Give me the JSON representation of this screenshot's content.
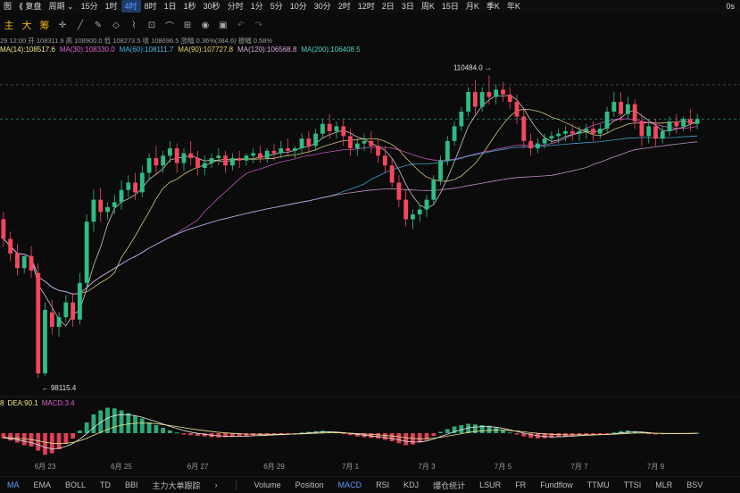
{
  "topbar": {
    "items": [
      {
        "label": "图",
        "icon": "chart-icon"
      },
      {
        "label": "⟪ 复盘"
      },
      {
        "label": "周期 ⌄"
      },
      {
        "label": "15分"
      },
      {
        "label": "1时"
      },
      {
        "label": "4时",
        "active": true
      },
      {
        "label": "8时"
      },
      {
        "label": "1日"
      },
      {
        "label": "1秒"
      },
      {
        "label": "30秒"
      },
      {
        "label": "分时"
      },
      {
        "label": "1分"
      },
      {
        "label": "5分"
      },
      {
        "label": "10分"
      },
      {
        "label": "30分"
      },
      {
        "label": "2时"
      },
      {
        "label": "12时"
      },
      {
        "label": "2日"
      },
      {
        "label": "3日"
      },
      {
        "label": "周K"
      },
      {
        "label": "15日"
      },
      {
        "label": "月K"
      },
      {
        "label": "季K"
      },
      {
        "label": "年K"
      }
    ],
    "countdown": "0s"
  },
  "toolbar": {
    "main": "主",
    "big": "大",
    "chips": "筹"
  },
  "info_line": "29 12:00 开 108311.9 高 108900.0 低 108273.5 收 108696.5 涨幅 0.36%(384.6) 振幅 0.58%",
  "ma_legend": [
    {
      "label": "MA(14):108517.6",
      "color": "#f0e68c"
    },
    {
      "label": "MA(30):108330.0",
      "color": "#e05fd4"
    },
    {
      "label": "MA(60):108111.7",
      "color": "#47b8e8"
    },
    {
      "label": "MA(90):107727.8",
      "color": "#e8d36a"
    },
    {
      "label": "MA(120):106568.8",
      "color": "#d9a7e0"
    },
    {
      "label": "MA(200):106408.5",
      "color": "#4ad6c6"
    }
  ],
  "macd_legend": [
    {
      "label": "8",
      "color": "#f0e68c"
    },
    {
      "label": "DEA:90.1",
      "color": "#f0e68c"
    },
    {
      "label": "MACD:3.4",
      "color": "#d864c8"
    }
  ],
  "annotations": {
    "high": "110484.0",
    "low": "98115.4"
  },
  "x_dates": [
    "6月 23",
    "6月 25",
    "6月 27",
    "6月 29",
    "7月 1",
    "7月 3",
    "7月 5",
    "7月 7",
    "7月 9"
  ],
  "bottombar": {
    "items": [
      "MA",
      "EMA",
      "BOLL",
      "TD",
      "BBI",
      "主力大单跟踪",
      "›"
    ],
    "sub_items": [
      "Volume",
      "Position",
      "MACD",
      "RSI",
      "KDJ",
      "爆仓统计",
      "LSUR",
      "FR",
      "Fundflow",
      "TTMU",
      "TTSI",
      "MLR",
      "BSV"
    ]
  },
  "colors": {
    "up": "#2ebd85",
    "down": "#f6465d",
    "accent": "#5d9bff"
  },
  "chart_data": {
    "type": "candlestick",
    "price_range": [
      97500,
      111300
    ],
    "high_marker": 110484.0,
    "low_marker": 98115.4,
    "candles": [
      {
        "o": 104600,
        "h": 104900,
        "c": 103800,
        "l": 103500
      },
      {
        "o": 103800,
        "h": 104100,
        "c": 103200,
        "l": 102900
      },
      {
        "o": 103200,
        "h": 103600,
        "c": 102600,
        "l": 102300
      },
      {
        "o": 102600,
        "h": 103000,
        "c": 103100,
        "l": 102400
      },
      {
        "o": 103100,
        "h": 103500,
        "c": 102500,
        "l": 102200
      },
      {
        "o": 102400,
        "h": 102800,
        "c": 98300,
        "l": 98115.4
      },
      {
        "o": 98300,
        "h": 101200,
        "c": 100900,
        "l": 98200
      },
      {
        "o": 100800,
        "h": 101300,
        "c": 100200,
        "l": 99900
      },
      {
        "o": 100200,
        "h": 100800,
        "c": 100600,
        "l": 99800
      },
      {
        "o": 100600,
        "h": 101500,
        "c": 101200,
        "l": 100400
      },
      {
        "o": 101200,
        "h": 101600,
        "c": 100500,
        "l": 100200
      },
      {
        "o": 100500,
        "h": 102400,
        "c": 102000,
        "l": 100300
      },
      {
        "o": 102000,
        "h": 104800,
        "c": 104500,
        "l": 101800
      },
      {
        "o": 104500,
        "h": 105800,
        "c": 105400,
        "l": 104100
      },
      {
        "o": 105400,
        "h": 105900,
        "c": 104900,
        "l": 104500
      },
      {
        "o": 104900,
        "h": 105300,
        "c": 105100,
        "l": 104600
      },
      {
        "o": 105100,
        "h": 105600,
        "c": 105300,
        "l": 104800
      },
      {
        "o": 105300,
        "h": 106200,
        "c": 105800,
        "l": 105000
      },
      {
        "o": 105800,
        "h": 106400,
        "c": 106100,
        "l": 105500
      },
      {
        "o": 106100,
        "h": 106500,
        "c": 105700,
        "l": 105400
      },
      {
        "o": 105700,
        "h": 106800,
        "c": 106500,
        "l": 105500
      },
      {
        "o": 106500,
        "h": 107300,
        "c": 107100,
        "l": 106200
      },
      {
        "o": 107100,
        "h": 107600,
        "c": 106800,
        "l": 106400
      },
      {
        "o": 106800,
        "h": 107400,
        "c": 107200,
        "l": 106500
      },
      {
        "o": 107200,
        "h": 107800,
        "c": 107500,
        "l": 106900
      },
      {
        "o": 107500,
        "h": 107700,
        "c": 106900,
        "l": 106500
      },
      {
        "o": 106900,
        "h": 107500,
        "c": 107300,
        "l": 106600
      },
      {
        "o": 107300,
        "h": 107800,
        "c": 107100,
        "l": 106800
      },
      {
        "o": 107100,
        "h": 107400,
        "c": 106700,
        "l": 106400
      },
      {
        "o": 106700,
        "h": 107200,
        "c": 106900,
        "l": 106400
      },
      {
        "o": 106900,
        "h": 107300,
        "c": 107100,
        "l": 106700
      },
      {
        "o": 107100,
        "h": 107500,
        "c": 107200,
        "l": 106800
      },
      {
        "o": 107200,
        "h": 107400,
        "c": 106800,
        "l": 106500
      },
      {
        "o": 106800,
        "h": 107300,
        "c": 107100,
        "l": 106600
      },
      {
        "o": 107100,
        "h": 107400,
        "c": 107000,
        "l": 106700
      },
      {
        "o": 107000,
        "h": 107300,
        "c": 107200,
        "l": 106800
      },
      {
        "o": 107200,
        "h": 107500,
        "c": 107300,
        "l": 106900
      },
      {
        "o": 107300,
        "h": 107600,
        "c": 107100,
        "l": 106900
      },
      {
        "o": 107100,
        "h": 107500,
        "c": 107400,
        "l": 106900
      },
      {
        "o": 107400,
        "h": 107700,
        "c": 107300,
        "l": 107000
      },
      {
        "o": 107300,
        "h": 107800,
        "c": 107500,
        "l": 107100
      },
      {
        "o": 107500,
        "h": 107900,
        "c": 107400,
        "l": 107200
      },
      {
        "o": 107400,
        "h": 107600,
        "c": 107500,
        "l": 107100
      },
      {
        "o": 107500,
        "h": 108100,
        "c": 107900,
        "l": 107300
      },
      {
        "o": 107900,
        "h": 108200,
        "c": 107600,
        "l": 107300
      },
      {
        "o": 107600,
        "h": 108300,
        "c": 108100,
        "l": 107400
      },
      {
        "o": 108100,
        "h": 108700,
        "c": 108500,
        "l": 107900
      },
      {
        "o": 108500,
        "h": 108900,
        "c": 108200,
        "l": 107900
      },
      {
        "o": 108200,
        "h": 108600,
        "c": 108400,
        "l": 107900
      },
      {
        "o": 108400,
        "h": 108700,
        "c": 108000,
        "l": 107600
      },
      {
        "o": 108000,
        "h": 108300,
        "c": 107500,
        "l": 107200
      },
      {
        "o": 107500,
        "h": 107900,
        "c": 107700,
        "l": 107200
      },
      {
        "o": 107700,
        "h": 108100,
        "c": 107800,
        "l": 107400
      },
      {
        "o": 107800,
        "h": 108200,
        "c": 107600,
        "l": 107300
      },
      {
        "o": 107600,
        "h": 107900,
        "c": 107200,
        "l": 106900
      },
      {
        "o": 107200,
        "h": 107600,
        "c": 106800,
        "l": 106500
      },
      {
        "o": 106800,
        "h": 107100,
        "c": 106100,
        "l": 105900
      },
      {
        "o": 106100,
        "h": 106400,
        "c": 105400,
        "l": 105100
      },
      {
        "o": 105400,
        "h": 105800,
        "c": 104600,
        "l": 104300
      },
      {
        "o": 104600,
        "h": 105000,
        "c": 104800,
        "l": 104200
      },
      {
        "o": 104800,
        "h": 105200,
        "c": 105000,
        "l": 104500
      },
      {
        "o": 105000,
        "h": 105600,
        "c": 105400,
        "l": 104700
      },
      {
        "o": 105400,
        "h": 106400,
        "c": 106200,
        "l": 105200
      },
      {
        "o": 106200,
        "h": 107200,
        "c": 107000,
        "l": 106000
      },
      {
        "o": 107000,
        "h": 108000,
        "c": 107800,
        "l": 106800
      },
      {
        "o": 107800,
        "h": 108600,
        "c": 108400,
        "l": 107600
      },
      {
        "o": 108400,
        "h": 109200,
        "c": 109000,
        "l": 108200
      },
      {
        "o": 109000,
        "h": 110000,
        "c": 109800,
        "l": 108800
      },
      {
        "o": 109800,
        "h": 110300,
        "c": 109200,
        "l": 108900
      },
      {
        "o": 109200,
        "h": 110000,
        "c": 109800,
        "l": 109000
      },
      {
        "o": 109800,
        "h": 110484.0,
        "c": 109600,
        "l": 109300
      },
      {
        "o": 109600,
        "h": 110100,
        "c": 109900,
        "l": 109300
      },
      {
        "o": 109900,
        "h": 110200,
        "c": 109700,
        "l": 109400
      },
      {
        "o": 109700,
        "h": 110000,
        "c": 109400,
        "l": 109100
      },
      {
        "o": 109400,
        "h": 109700,
        "c": 108800,
        "l": 108500
      },
      {
        "o": 108800,
        "h": 109100,
        "c": 107800,
        "l": 107500
      },
      {
        "o": 107800,
        "h": 108100,
        "c": 107500,
        "l": 107200
      },
      {
        "o": 107500,
        "h": 107900,
        "c": 107700,
        "l": 107300
      },
      {
        "o": 107700,
        "h": 108100,
        "c": 107900,
        "l": 107500
      },
      {
        "o": 107900,
        "h": 108200,
        "c": 108000,
        "l": 107700
      },
      {
        "o": 108000,
        "h": 108300,
        "c": 108100,
        "l": 107700
      },
      {
        "o": 108100,
        "h": 108400,
        "c": 108200,
        "l": 107800
      },
      {
        "o": 108200,
        "h": 108500,
        "c": 108100,
        "l": 107800
      },
      {
        "o": 108100,
        "h": 108400,
        "c": 108200,
        "l": 107800
      },
      {
        "o": 108200,
        "h": 108500,
        "c": 108300,
        "l": 107900
      },
      {
        "o": 108300,
        "h": 108600,
        "c": 108100,
        "l": 107800
      },
      {
        "o": 108100,
        "h": 108500,
        "c": 108300,
        "l": 107900
      },
      {
        "o": 108300,
        "h": 109200,
        "c": 109000,
        "l": 108100
      },
      {
        "o": 109000,
        "h": 109800,
        "c": 109400,
        "l": 108800
      },
      {
        "o": 109400,
        "h": 109800,
        "c": 108900,
        "l": 108600
      },
      {
        "o": 108900,
        "h": 109600,
        "c": 109300,
        "l": 108700
      },
      {
        "o": 109300,
        "h": 109500,
        "c": 108600,
        "l": 108300
      },
      {
        "o": 108600,
        "h": 108900,
        "c": 108000,
        "l": 107600
      },
      {
        "o": 108000,
        "h": 108600,
        "c": 108400,
        "l": 107700
      },
      {
        "o": 108400,
        "h": 108700,
        "c": 107900,
        "l": 107600
      },
      {
        "o": 107900,
        "h": 108400,
        "c": 108200,
        "l": 107700
      },
      {
        "o": 108200,
        "h": 108800,
        "c": 108600,
        "l": 108000
      },
      {
        "o": 108600,
        "h": 108900,
        "c": 108400,
        "l": 108100
      },
      {
        "o": 108400,
        "h": 108800,
        "c": 108700,
        "l": 108200
      },
      {
        "o": 108700,
        "h": 109100,
        "c": 108500,
        "l": 108200
      },
      {
        "o": 108500,
        "h": 108900,
        "c": 108696.5,
        "l": 108273.5
      }
    ],
    "dashed_lines": [
      110100,
      108700
    ],
    "macd_hist": [
      -40,
      -55,
      -70,
      -90,
      -100,
      -130,
      -160,
      -150,
      -120,
      -80,
      -40,
      20,
      80,
      140,
      170,
      190,
      185,
      170,
      150,
      130,
      110,
      80,
      60,
      40,
      20,
      5,
      -10,
      -15,
      -20,
      -25,
      -30,
      -32,
      -30,
      -28,
      -25,
      -22,
      -18,
      -15,
      -12,
      -10,
      -8,
      -5,
      -2,
      5,
      10,
      15,
      18,
      12,
      6,
      -5,
      -15,
      -25,
      -30,
      -35,
      -40,
      -50,
      -60,
      -75,
      -90,
      -85,
      -70,
      -50,
      -20,
      10,
      30,
      50,
      60,
      70,
      65,
      60,
      55,
      40,
      20,
      5,
      -10,
      -25,
      -35,
      -40,
      -38,
      -35,
      -30,
      -25,
      -20,
      -15,
      -12,
      -10,
      -8,
      -5,
      5,
      15,
      20,
      15,
      8,
      -5,
      -10,
      -8,
      -5,
      -3,
      -2,
      -1,
      3
    ],
    "macd_range": [
      -200,
      200
    ]
  }
}
